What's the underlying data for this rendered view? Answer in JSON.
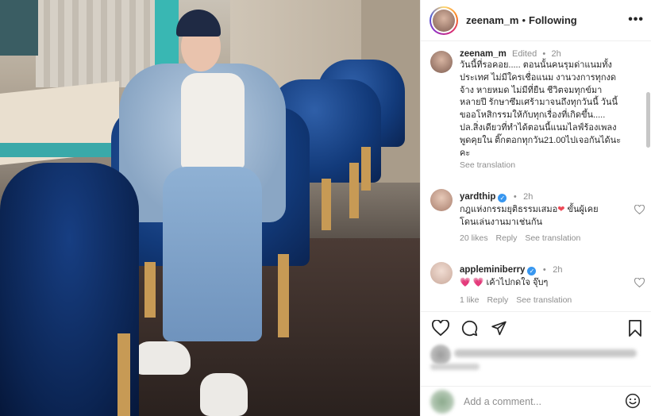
{
  "post": {
    "username": "zeenam_m",
    "separator": "•",
    "follow_status": "Following",
    "more_label": "•••"
  },
  "caption": {
    "username": "zeenam_m",
    "edited": "Edited",
    "dot": "•",
    "time": "2h",
    "text": "วันนี้ที่รอคอย..... ตอนนั้นคนรุมด่าแนมทั้ง\nประเทศ ไม่มีใครเชื่อแนม งานวงการทุกงด\nจ้าง หายหมด ไม่มีที่ยืน ชีวิตจมทุกข์มา\nหลายปี รักษาซึมเศร้ามาจนถึงทุกวันนี้ วันนี้\nขออโหสิกรรมให้กับทุกเรื่องที่เกิดขึ้น.....\nปล.สิ่งเดียวที่ทำได้ตอนนี้แนมไลฟ์ร้องเพลง\nพูดคุยใน ติ๊กตอกทุกวัน21.00ไปเจอกันได้นะ\nคะ",
    "see_translation": "See translation"
  },
  "comments": [
    {
      "username": "yardthip",
      "verified": true,
      "dot": "•",
      "time": "2h",
      "text_before": "กฎแห่งกรรมยุติธรรมเสมอ",
      "emoji": "❤",
      "text_after": " ขั้นผู้เคย\nโดนเล่นงานมาเช่นกัน",
      "likes": "20 likes",
      "reply": "Reply",
      "see_translation": "See translation"
    },
    {
      "username": "appleminiberry",
      "verified": true,
      "dot": "•",
      "time": "2h",
      "text_before": "",
      "emoji": "💗 💗",
      "text_after": " เค้าไปกดใจ จุ๊บๆ",
      "likes": "1 like",
      "reply": "Reply",
      "see_translation": "See translation"
    }
  ],
  "actions": {
    "like_icon": "heart-outline-icon",
    "comment_icon": "comment-bubble-icon",
    "share_icon": "paper-plane-icon",
    "save_icon": "bookmark-icon"
  },
  "add_comment": {
    "placeholder": "Add a comment..."
  },
  "colors": {
    "accent": "#3897f0",
    "heart": "#ed4956",
    "secondary_text": "#8e8e8e"
  }
}
